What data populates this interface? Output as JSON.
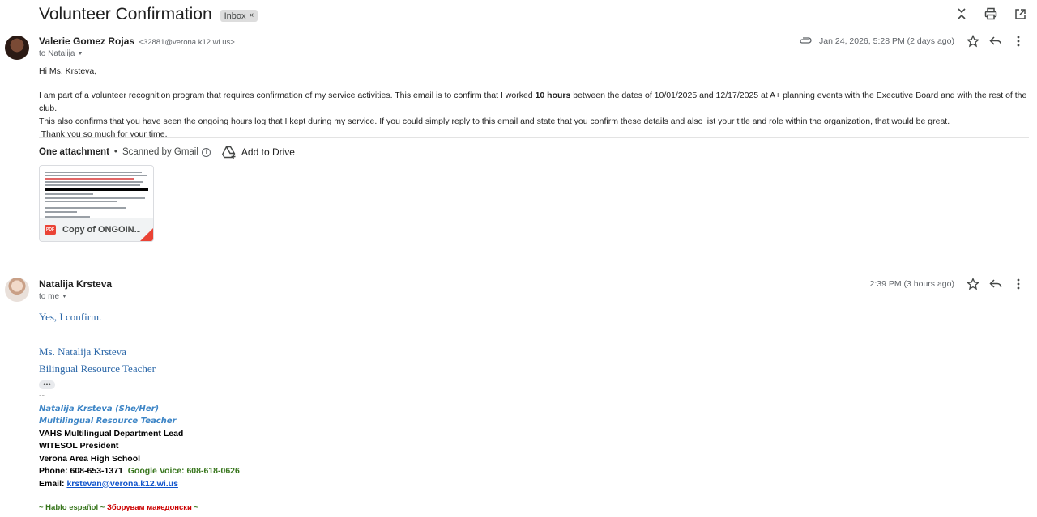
{
  "subject": "Volunteer Confirmation",
  "label": "Inbox",
  "label_close": "×",
  "top_icons": [
    "collapse-icon",
    "print-icon",
    "open-new-window-icon"
  ],
  "message1": {
    "sender_name": "Valerie Gomez Rojas",
    "sender_email": "<32881@verona.k12.wi.us>",
    "to": "to Natalija",
    "timestamp": "Jan 24, 2026, 5:28 PM (2 days ago)",
    "greeting": "Hi Ms. Krsteva,",
    "para_part1": "I am part of a volunteer recognition program that requires confirmation of my service activities. This email is to confirm that I worked ",
    "para_bold": "10 hours",
    "para_part2": " between the dates of 10/01/2025 and 12/17/2025 at A+ planning events with the Executive Board and with the rest of the club.",
    "para_line2_a": "This also confirms that you have seen the ongoing hours log that I kept during my service. If you could simply reply to this email and state that you confirm these details and also ",
    "para_link": "list your title and role within the organization",
    "para_line2_b": ", that would be great.",
    "thanks": " Thank you so much for your time."
  },
  "attachments": {
    "heading": "One attachment",
    "dot": "•",
    "scanned": "Scanned by Gmail",
    "info_glyph": "i",
    "add_drive": "Add to Drive",
    "file_name": "Copy of ONGOIN...",
    "file_type": "PDF"
  },
  "message2": {
    "sender_name": "Natalija Krsteva",
    "to": "to me",
    "timestamp": "2:39 PM (3 hours ago)",
    "reply": "Yes, I confirm.",
    "sig_name": "Ms. Natalija Krsteva",
    "sig_title": "Bilingual Resource Teacher",
    "ellipsis": "•••",
    "dashes": "--",
    "sig2_name": "Natalija Krsteva (She/Her)",
    "sig2_title": "Multilingual Resource Teacher",
    "dept": "VAHS Multilingual Department Lead",
    "witesol": "WITESOL President",
    "school": "Verona Area High School",
    "phone": "Phone: 608-653-1371",
    "gvoice": "Google Voice: 608-618-0626",
    "email_label": "Email: ",
    "email": "krstevan@verona.k12.wi.us",
    "lang_a": "~ Hablo español ~ ",
    "lang_b": "Зборувам македонски",
    "lang_c": " ~"
  },
  "colors": {
    "serif_blue": "#2b67a8",
    "sig_blue": "#3d85c6",
    "green": "#38761d",
    "red": "#cc0000",
    "link": "#1155cc"
  }
}
